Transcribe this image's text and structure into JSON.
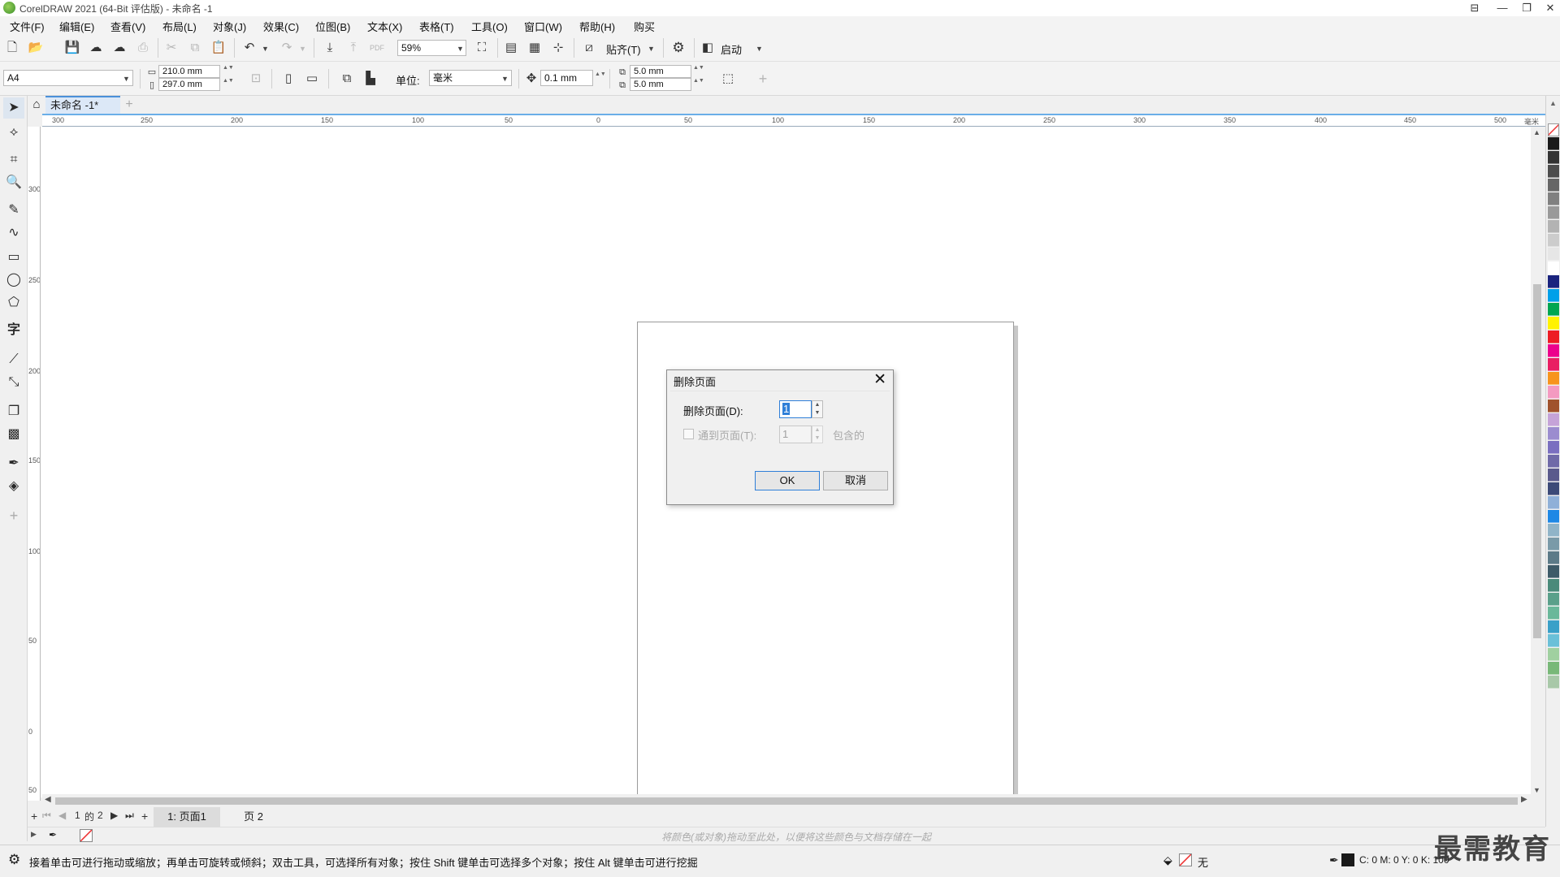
{
  "window": {
    "title": "CorelDRAW 2021 (64-Bit 评估版) - 未命名 -1",
    "controls": [
      "⊟",
      "—",
      "❐",
      "✕"
    ]
  },
  "menu": [
    "文件(F)",
    "编辑(E)",
    "查看(V)",
    "布局(L)",
    "对象(J)",
    "效果(C)",
    "位图(B)",
    "文本(X)",
    "表格(T)",
    "工具(O)",
    "窗口(W)",
    "帮助(H)",
    "购买"
  ],
  "toolbar": {
    "zoom": "59%",
    "snap_label": "贴齐(T)",
    "launch_label": "启动"
  },
  "propertybar": {
    "page_size": "A4",
    "width": "210.0 mm",
    "height": "297.0 mm",
    "unit_label": "单位:",
    "unit_value": "毫米",
    "nudge": "0.1 mm",
    "dup_x": "5.0 mm",
    "dup_y": "5.0 mm"
  },
  "doc_tab": {
    "label": "未命名 -1*"
  },
  "ruler": {
    "h_ticks": [
      "300",
      "250",
      "200",
      "150",
      "100",
      "50",
      "0",
      "50",
      "100",
      "150",
      "200",
      "250",
      "300",
      "350",
      "400",
      "450",
      "500"
    ],
    "h_unit": "毫米",
    "v_ticks": [
      "300",
      "250",
      "200",
      "150",
      "100",
      "50",
      "0",
      "50"
    ]
  },
  "dialog": {
    "title": "删除页面",
    "delete_page_label": "删除页面(D):",
    "delete_page_value": "1",
    "through_label": "通到页面(T):",
    "through_value": "1",
    "inclusive_label": "包含的",
    "ok_label": "OK",
    "cancel_label": "取消"
  },
  "pagenav": {
    "current": "1",
    "of_label": "的",
    "total": "2",
    "tabs": [
      "1: 页面1",
      "页 2"
    ]
  },
  "colorbar": {
    "hint": "将颜色(或对象)拖动至此处，以便将这些颜色与文档存储在一起"
  },
  "status": {
    "message": "接着单击可进行拖动或缩放；再单击可旋转或倾斜；双击工具，可选择所有对象；按住 Shift 键单击可选择多个对象；按住 Alt 键单击可进行挖掘",
    "fill_label": "无",
    "cmyk": "C: 0 M: 0 Y: 0 K: 100",
    "watermark": "最需教育"
  },
  "palette_colors": [
    "#ffffff",
    "#1a1a1a",
    "#333333",
    "#4d4d4d",
    "#666666",
    "#808080",
    "#999999",
    "#b3b3b3",
    "#cccccc",
    "#e6e6e6",
    "#ffffff",
    "#1a237e",
    "#00a0e9",
    "#00a651",
    "#fff200",
    "#ed1c24",
    "#ec008c",
    "#e91e63",
    "#f7941d",
    "#f49ac1",
    "#a0522d",
    "#c5a3d8",
    "#9b8ccf",
    "#7a6fc0",
    "#6f6aa8",
    "#5a5a8c",
    "#3c4a78",
    "#8fb0d8",
    "#1e88e5",
    "#90b4c8",
    "#7a9aa8",
    "#5c7a88",
    "#3d5a68",
    "#4a8a7a",
    "#5aa08a",
    "#6ab89a",
    "#3aa0c8",
    "#6ac0d8",
    "#a0d0a0",
    "#78b878",
    "#a8c8a8"
  ]
}
